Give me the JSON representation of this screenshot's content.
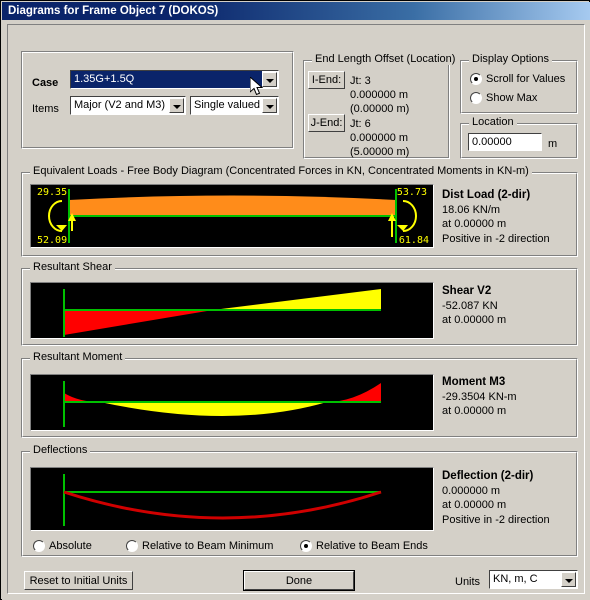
{
  "window": {
    "title": "Diagrams for Frame Object 7  (DOKOS)"
  },
  "case_group": {
    "case_label": "Case",
    "case_value": "1.35G+1.5Q",
    "items_label": "Items",
    "items_value": "Major (V2 and M3)",
    "valued_value": "Single valued"
  },
  "end_offset": {
    "title": "End Length Offset (Location)",
    "i_end_button": "I-End:",
    "i_end_jt": "Jt:  3",
    "i_end_offset": "0.000000 m",
    "i_end_location": "(0.00000 m)",
    "j_end_button": "J-End:",
    "j_end_jt": "Jt:  6",
    "j_end_offset": "0.000000 m",
    "j_end_location": "(5.00000 m)"
  },
  "display_options": {
    "title": "Display Options",
    "options": [
      {
        "label": "Scroll for Values",
        "selected": true
      },
      {
        "label": "Show Max",
        "selected": false
      }
    ]
  },
  "location": {
    "title": "Location",
    "value": "0.00000",
    "units": "m"
  },
  "equivalent_loads": {
    "title": "Equivalent Loads - Free Body Diagram  (Concentrated Forces in KN, Concentrated Moments in KN-m)",
    "labels": {
      "top_left": "29.35",
      "bottom_left": "52.09",
      "top_right": "53.73",
      "bottom_right": "61.84"
    },
    "readout": [
      "Dist Load (2-dir)",
      "18.06 KN/m",
      "at 0.00000 m",
      "Positive in -2 direction"
    ]
  },
  "resultant_shear": {
    "title": "Resultant Shear",
    "readout": [
      "Shear V2",
      "-52.087 KN",
      "at 0.00000 m"
    ]
  },
  "resultant_moment": {
    "title": "Resultant Moment",
    "readout": [
      "Moment M3",
      "-29.3504 KN-m",
      "at 0.00000 m"
    ]
  },
  "deflections": {
    "title": "Deflections",
    "readout": [
      "Deflection (2-dir)",
      "0.000000 m",
      "at 0.00000 m",
      "Positive in -2 direction"
    ],
    "options": [
      {
        "label": "Absolute",
        "selected": false
      },
      {
        "label": "Relative to Beam Minimum",
        "selected": false
      },
      {
        "label": "Relative to Beam Ends",
        "selected": true
      }
    ]
  },
  "footer": {
    "reset_button": "Reset to Initial Units",
    "done_button": "Done",
    "units_label": "Units",
    "units_value": "KN, m, C"
  },
  "colors": {
    "title_bar": "#0a246a",
    "face": "#d4d0c8",
    "diagram_bg": "#000000",
    "load_fill": "#ff8c1a",
    "axis_green": "#00c000",
    "moment_yellow": "#ffff00",
    "shear_red": "#ff0000",
    "annotation_yellow": "#ffff00"
  },
  "chart_data": [
    {
      "type": "area",
      "name": "equivalent-loads-free-body",
      "title": "Equivalent Loads - Free Body Diagram",
      "xlabel": "",
      "ylabel": "",
      "xlim": [
        0,
        5
      ],
      "end_forces": {
        "i_moment": 29.35,
        "i_shear": 52.09,
        "j_moment": 53.73,
        "j_shear": 61.84
      },
      "distributed_load": 18.06,
      "units": "KN, KN-m, KN/m"
    },
    {
      "type": "area",
      "name": "resultant-shear",
      "title": "Shear V2",
      "xlabel": "",
      "ylabel": "KN",
      "xlim": [
        0,
        5
      ],
      "x": [
        0,
        1.25,
        2.5,
        3.75,
        5
      ],
      "values": [
        -52.087,
        -26.0,
        0.0,
        26.0,
        61.84
      ]
    },
    {
      "type": "area",
      "name": "resultant-moment",
      "title": "Moment M3",
      "xlabel": "",
      "ylabel": "KN-m",
      "xlim": [
        0,
        5
      ],
      "x": [
        0,
        0.625,
        1.25,
        2.5,
        3.75,
        4.375,
        5
      ],
      "values": [
        -29.3504,
        0.0,
        16.0,
        24.0,
        16.0,
        0.0,
        -53.73
      ]
    },
    {
      "type": "line",
      "name": "deflection-shape",
      "title": "Deflection (2-dir)",
      "xlabel": "",
      "ylabel": "m",
      "xlim": [
        0,
        5
      ],
      "x": [
        0,
        1.25,
        2.5,
        3.75,
        5
      ],
      "values": [
        0.0,
        -0.72,
        -1.0,
        -0.72,
        0.0
      ]
    }
  ]
}
